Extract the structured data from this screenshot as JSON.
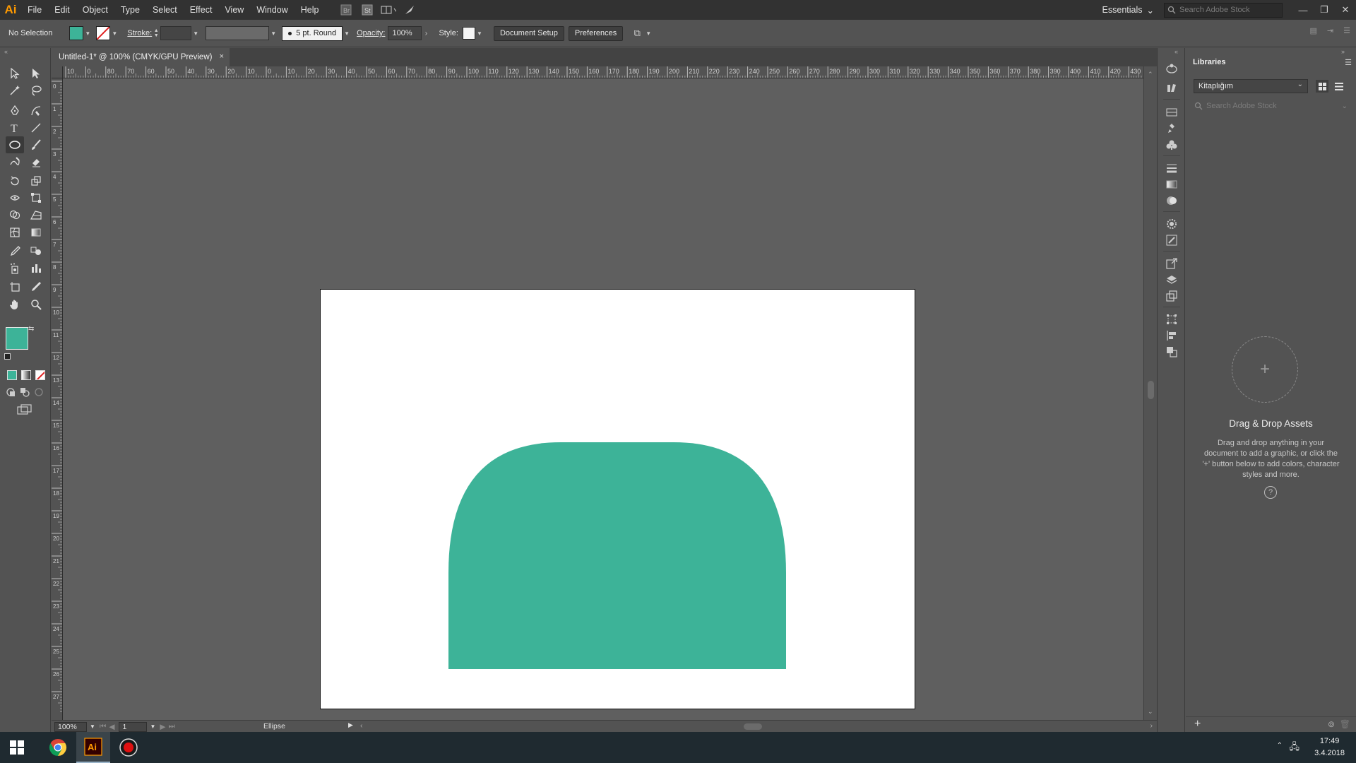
{
  "app": {
    "logo_text": "Ai",
    "menu": [
      "File",
      "Edit",
      "Object",
      "Type",
      "Select",
      "Effect",
      "View",
      "Window",
      "Help"
    ],
    "workspace": "Essentials",
    "stock_search_placeholder": "Search Adobe Stock"
  },
  "control_bar": {
    "selection_label": "No Selection",
    "fill_color": "#3db398",
    "stroke_label": "Stroke:",
    "brush_label": "5 pt. Round",
    "opacity_label": "Opacity:",
    "opacity_value": "100%",
    "style_label": "Style:",
    "document_setup": "Document Setup",
    "preferences": "Preferences"
  },
  "document": {
    "tab_title": "Untitled-1* @ 100% (CMYK/GPU Preview)",
    "close_glyph": "×",
    "shape_color": "#3db398",
    "artboard_color": "#ffffff",
    "canvas_color": "#5f5f5f"
  },
  "rulers": {
    "top_labels": [
      "10",
      "0",
      "80",
      "70",
      "60",
      "50",
      "40",
      "30",
      "20",
      "10",
      "0",
      "10",
      "20",
      "30",
      "40",
      "50",
      "60",
      "70",
      "80",
      "90",
      "100",
      "110",
      "120",
      "130",
      "140",
      "150",
      "160",
      "170",
      "180",
      "190",
      "200",
      "210",
      "220",
      "230",
      "240",
      "250",
      "260",
      "270",
      "280",
      "290",
      "300",
      "310",
      "320",
      "330",
      "340",
      "350",
      "360",
      "370",
      "380",
      "390",
      "400",
      "410",
      "420",
      "430"
    ],
    "left_labels": [
      "0",
      "1",
      "2",
      "3",
      "4",
      "5",
      "6",
      "7",
      "8",
      "9",
      "10",
      "11",
      "12",
      "13",
      "14",
      "15",
      "16",
      "17",
      "18",
      "19",
      "20",
      "21",
      "22",
      "23",
      "24",
      "25",
      "26",
      "27"
    ]
  },
  "status": {
    "zoom": "100%",
    "page": "1",
    "tool": "Ellipse"
  },
  "libraries": {
    "tab": "Libraries",
    "library_name": "Kitaplığım",
    "search_placeholder": "Search Adobe Stock",
    "add_glyph": "+",
    "heading": "Drag & Drop Assets",
    "description": "Drag and drop anything in your document to add a graphic, or click the '+' button below to add colors, character styles and more.",
    "help_glyph": "?"
  },
  "taskbar": {
    "time": "17:49",
    "date": "3.4.2018",
    "apps": [
      "windows-start",
      "chrome",
      "illustrator",
      "recorder"
    ]
  }
}
